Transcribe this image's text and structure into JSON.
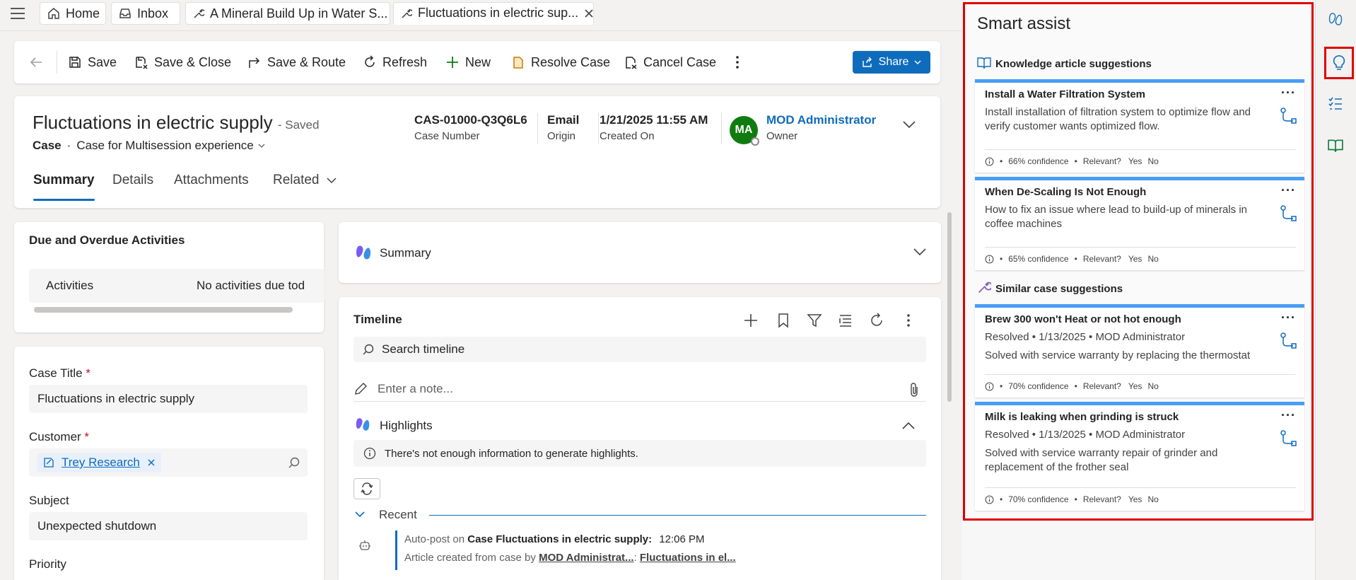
{
  "tabs": {
    "home": "Home",
    "inbox": "Inbox",
    "tab3": "A Mineral Build Up in Water S...",
    "tab4": "Fluctuations in electric sup..."
  },
  "commands": {
    "save": "Save",
    "save_close": "Save & Close",
    "save_route": "Save & Route",
    "refresh": "Refresh",
    "new": "New",
    "resolve": "Resolve Case",
    "cancel": "Cancel Case",
    "share": "Share"
  },
  "header": {
    "title": "Fluctuations in electric supply",
    "saved": "- Saved",
    "entity": "Case",
    "dot": "·",
    "form": "Case for Multisession experience",
    "case_number": "CAS-01000-Q3Q6L6",
    "case_number_label": "Case Number",
    "origin": "Email",
    "origin_label": "Origin",
    "created_on": "1/21/2025 11:55 AM",
    "created_on_label": "Created On",
    "owner_initials": "MA",
    "owner": "MOD Administrator",
    "owner_label": "Owner"
  },
  "form_tabs": [
    "Summary",
    "Details",
    "Attachments",
    "Related"
  ],
  "due": {
    "title": "Due and Overdue Activities",
    "col": "Activities",
    "empty": "No activities due tod"
  },
  "fields": {
    "case_title_label": "Case Title",
    "case_title": "Fluctuations in electric supply",
    "customer_label": "Customer",
    "customer": "Trey Research",
    "subject_label": "Subject",
    "subject": "Unexpected shutdown",
    "priority_label": "Priority",
    "required": "*"
  },
  "summary": {
    "title": "Summary"
  },
  "timeline": {
    "title": "Timeline",
    "search_placeholder": "Search timeline",
    "note_placeholder": "Enter a note...",
    "highlights": "Highlights",
    "highlights_msg": "There's not enough information to generate highlights.",
    "recent": "Recent",
    "post_prefix": "Auto-post on",
    "post_case": "Case Fluctuations in electric supply:",
    "post_time": "12:06 PM",
    "post_line2_prefix": "Article created from case by",
    "post_author": "MOD Administrat...",
    "post_sep": ":",
    "post_link": "Fluctuations in el..."
  },
  "smart_assist": {
    "title": "Smart assist",
    "kb_section": "Knowledge article suggestions",
    "similar_section": "Similar case suggestions",
    "relevant": "Relevant?",
    "yes": "Yes",
    "no": "No",
    "bullet": "•",
    "kb": [
      {
        "title": "Install a Water Filtration System",
        "desc": "Install installation of filtration system to optimize flow and verify customer wants optimized flow.",
        "confidence": "66% confidence"
      },
      {
        "title": "When De-Scaling Is Not Enough",
        "desc": "How to fix an issue where lead to build-up of minerals in coffee machines",
        "confidence": "65% confidence"
      }
    ],
    "cases": [
      {
        "title": "Brew 300 won't Heat or not hot enough",
        "meta": "Resolved • 1/13/2025 • MOD Administrator",
        "desc": "Solved with service warranty by replacing the thermostat",
        "confidence": "70% confidence"
      },
      {
        "title": "Milk is leaking when grinding is struck",
        "meta": "Resolved • 1/13/2025 • MOD Administrator",
        "desc": "Solved with service warranty repair of grinder and replacement of the frother seal",
        "confidence": "70% confidence"
      }
    ]
  },
  "colors": {
    "accent": "#0f6cbd",
    "highlight_border": "#e00000",
    "card_top": "#479ef5",
    "avatar": "#107c10"
  }
}
